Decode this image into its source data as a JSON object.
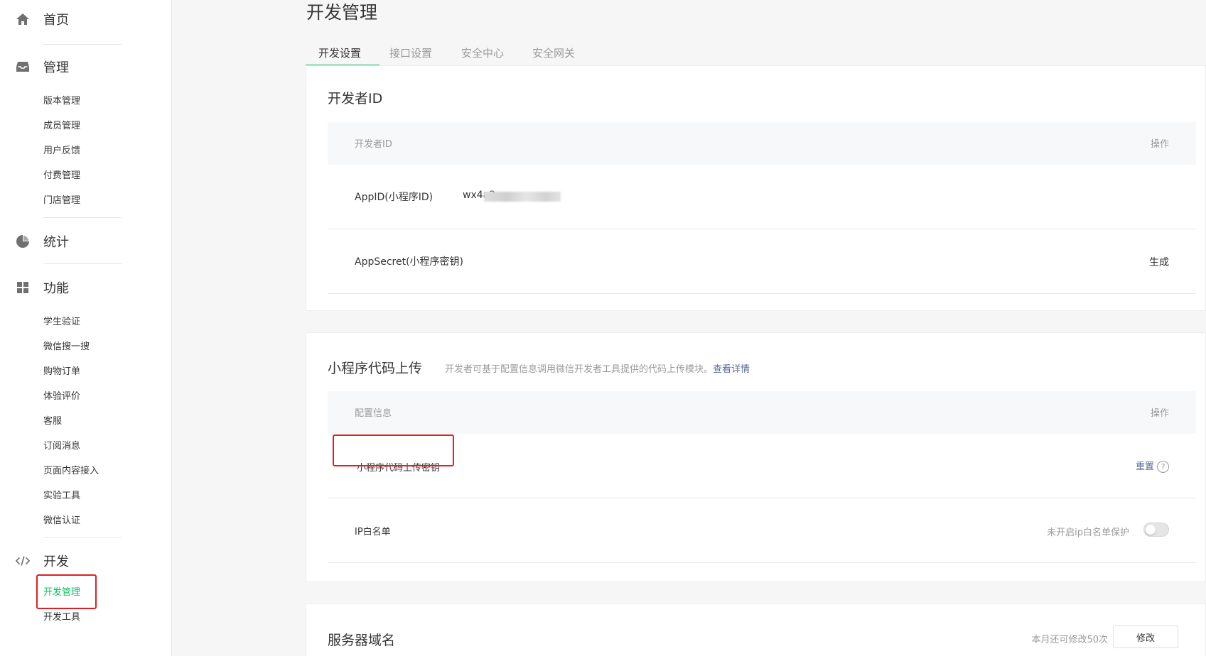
{
  "sidebar": {
    "home": {
      "label": "首页"
    },
    "manage": {
      "label": "管理",
      "items": [
        "版本管理",
        "成员管理",
        "用户反馈",
        "付费管理",
        "门店管理"
      ]
    },
    "stats": {
      "label": "统计"
    },
    "features": {
      "label": "功能",
      "items": [
        "学生验证",
        "微信搜一搜",
        "购物订单",
        "体验评价",
        "客服",
        "订阅消息",
        "页面内容接入",
        "实验工具",
        "微信认证"
      ]
    },
    "dev": {
      "label": "开发",
      "items": [
        "开发管理",
        "开发工具"
      ],
      "active_index": 0
    }
  },
  "page": {
    "title": "开发管理"
  },
  "tabs": [
    "开发设置",
    "接口设置",
    "安全中心",
    "安全网关"
  ],
  "developer_id": {
    "title": "开发者ID",
    "header": {
      "col1": "开发者ID",
      "col2": "操作"
    },
    "rows": [
      {
        "label": "AppID(小程序ID)",
        "value": "wx4a2"
      },
      {
        "label": "AppSecret(小程序密钥)",
        "action": "生成"
      }
    ]
  },
  "code_upload": {
    "title": "小程序代码上传",
    "desc": "开发者可基于配置信息调用微信开发者工具提供的代码上传模块。",
    "desc_link": "查看详情",
    "header": {
      "col1": "配置信息",
      "col2": "操作"
    },
    "rows": [
      {
        "label": "小程序代码上传密钥",
        "action": "重置",
        "help": "?"
      },
      {
        "label": "IP白名单",
        "status": "未开启ip白名单保护",
        "toggle_on": false
      }
    ]
  },
  "server_domain": {
    "title": "服务器域名",
    "remaining": "本月还可修改50次",
    "modify": "修改"
  },
  "colors": {
    "accent": "#07c160",
    "link": "#576b95",
    "highlight_box": "#e02020"
  }
}
